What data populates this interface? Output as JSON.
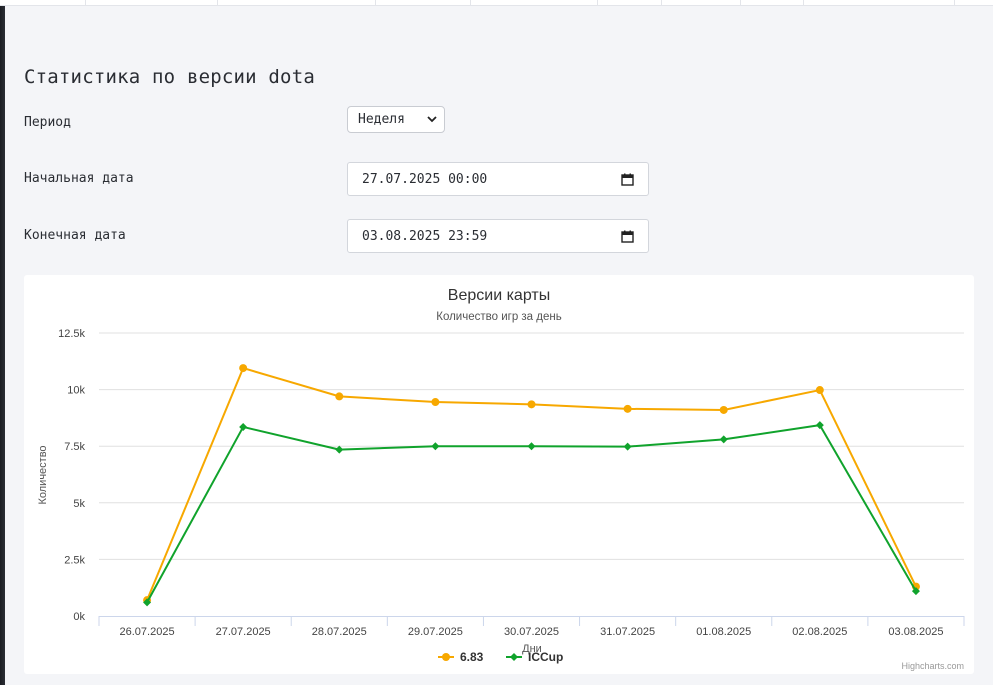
{
  "page": {
    "title": "Статистика по версии dota"
  },
  "form": {
    "period_label": "Период",
    "period_value": "Неделя",
    "start_label": "Начальная дата",
    "start_value": "27.07.2025 00:00",
    "end_label": "Конечная дата",
    "end_value": "03.08.2025 23:59"
  },
  "chart_data": {
    "type": "line",
    "title": "Версии карты",
    "subtitle": "Количество игр за день",
    "xlabel": "Дни",
    "ylabel": "Количество",
    "categories": [
      "26.07.2025",
      "27.07.2025",
      "28.07.2025",
      "29.07.2025",
      "30.07.2025",
      "31.07.2025",
      "01.08.2025",
      "02.08.2025",
      "03.08.2025"
    ],
    "ylim": [
      0,
      12500
    ],
    "yticks": [
      0,
      2500,
      5000,
      7500,
      10000,
      12500
    ],
    "ytick_labels": [
      "0k",
      "2.5k",
      "5k",
      "7.5k",
      "10k",
      "12.5k"
    ],
    "grid": true,
    "legend_position": "bottom-center",
    "credits": "Highcharts.com",
    "series": [
      {
        "name": "6.83",
        "color": "#f7a800",
        "marker": "circle",
        "values": [
          700,
          10950,
          9700,
          9450,
          9350,
          9150,
          9100,
          9980,
          1300
        ]
      },
      {
        "name": "ICCup",
        "color": "#10a32c",
        "marker": "diamond",
        "values": [
          600,
          8350,
          7350,
          7500,
          7500,
          7480,
          7800,
          8430,
          1100
        ]
      }
    ]
  }
}
